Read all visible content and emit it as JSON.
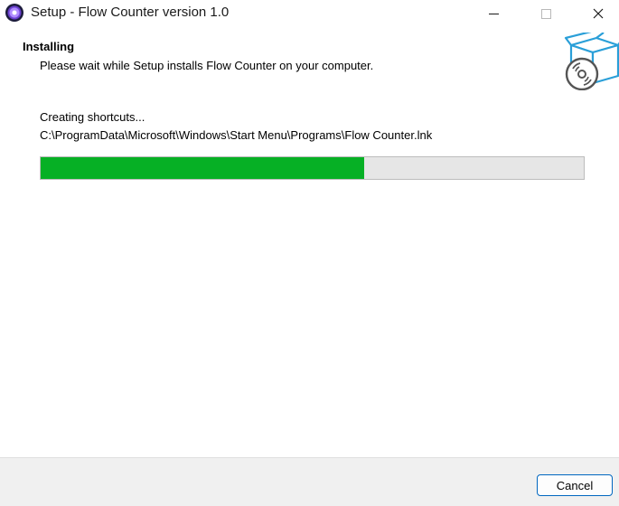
{
  "window": {
    "title": "Setup - Flow Counter version 1.0"
  },
  "header": {
    "title": "Installing",
    "subtitle": "Please wait while Setup installs Flow Counter on your computer.",
    "icon": "setup-box-disc-icon"
  },
  "main": {
    "status": "Creating shortcuts...",
    "current_path": "C:\\ProgramData\\Microsoft\\Windows\\Start Menu\\Programs\\Flow Counter.lnk",
    "progress_fraction": 0.595
  },
  "footer": {
    "cancel_label": "Cancel"
  },
  "colors": {
    "progress_fill": "#06b025",
    "progress_track": "#e6e6e6",
    "accent": "#0067c0",
    "icon_blue": "#2a9fd8"
  }
}
